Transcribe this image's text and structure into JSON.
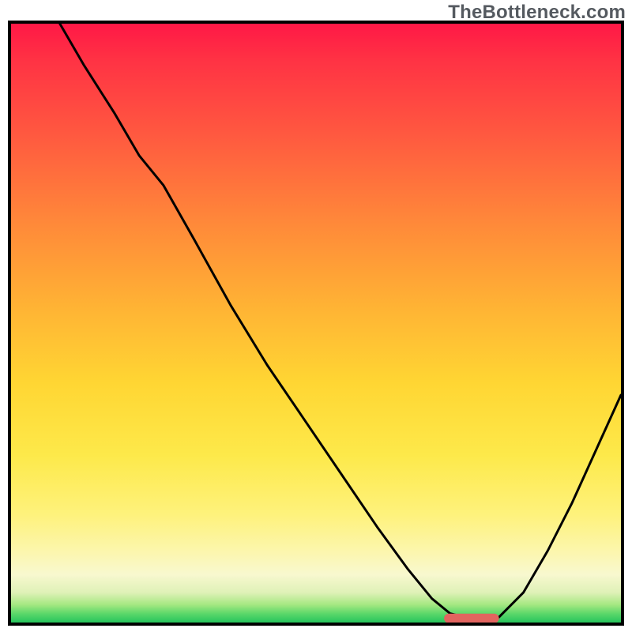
{
  "watermark": "TheBottleneck.com",
  "colors": {
    "curve": "#000000",
    "marker": "#e2645f",
    "border": "#000000"
  },
  "chart_data": {
    "type": "line",
    "title": "",
    "xlabel": "",
    "ylabel": "",
    "ylim": [
      0,
      100
    ],
    "xlim": [
      0,
      100
    ],
    "annotations": [
      {
        "name": "sweet_spot",
        "x_start": 71,
        "x_end": 80,
        "y": 99.3
      }
    ],
    "series": [
      {
        "name": "bottleneck_curve",
        "x": [
          8,
          12,
          17,
          21,
          25,
          30,
          36,
          42,
          48,
          54,
          60,
          65,
          69,
          72,
          75,
          78,
          80,
          84,
          88,
          92,
          96,
          100
        ],
        "y": [
          0,
          7,
          15,
          22,
          27,
          36,
          47,
          57,
          66,
          75,
          84,
          91,
          96,
          98.5,
          99.3,
          99.3,
          99.1,
          95,
          88,
          80,
          71,
          62
        ]
      }
    ]
  }
}
